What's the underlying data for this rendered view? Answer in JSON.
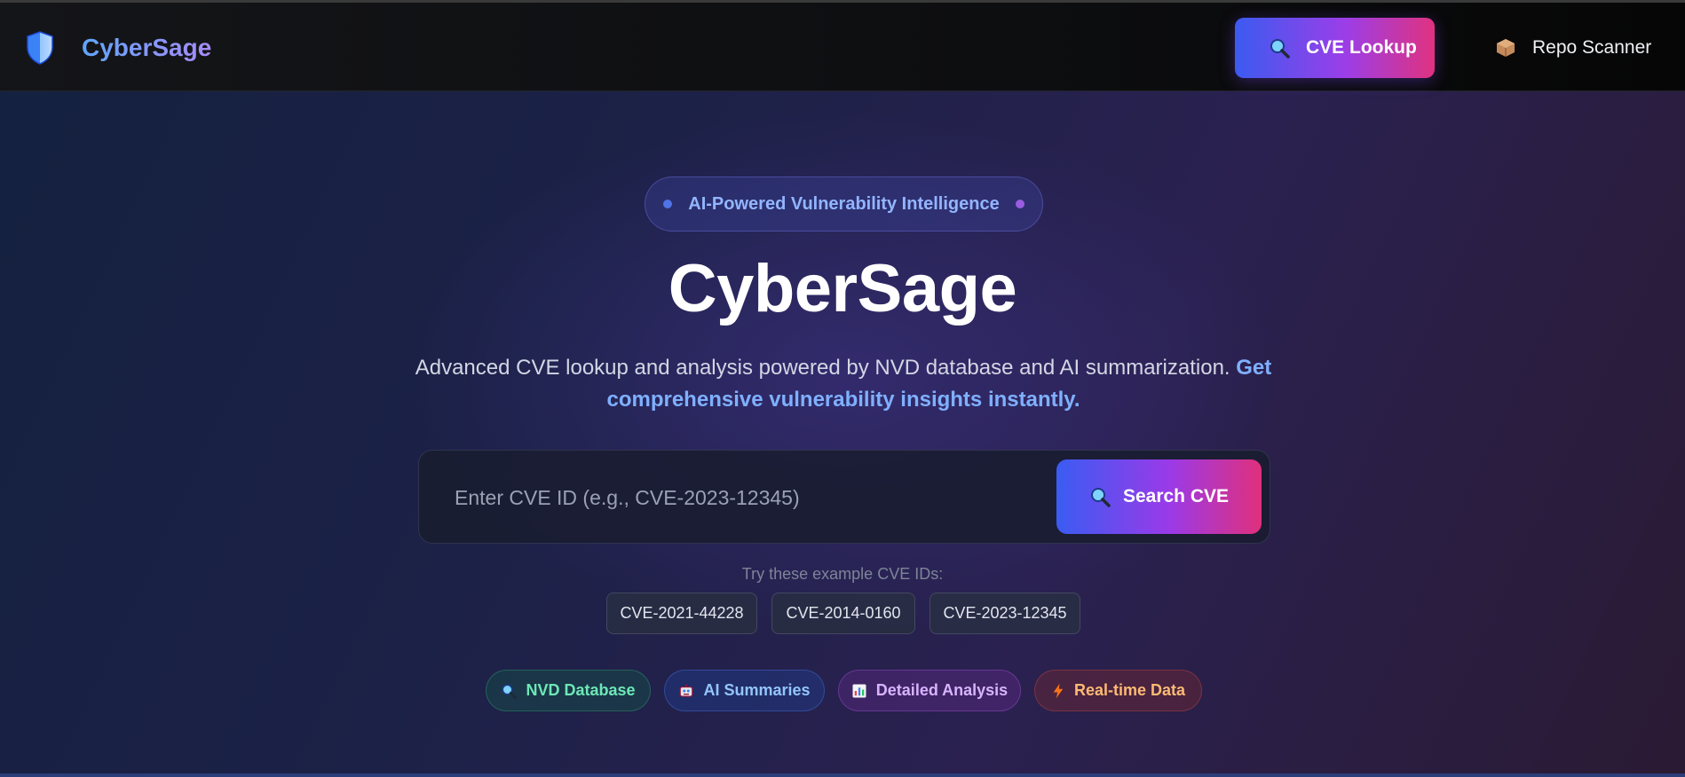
{
  "navbar": {
    "brand_name": "CyberSage",
    "brand_icon": "shield-icon",
    "links": [
      {
        "label": "CVE Lookup",
        "icon": "magnifier-icon",
        "active": true
      },
      {
        "label": "Repo Scanner",
        "icon": "package-icon",
        "active": false
      }
    ]
  },
  "hero": {
    "badge": "AI-Powered Vulnerability Intelligence",
    "title": "CyberSage",
    "subtitle": "Advanced CVE lookup and analysis powered by NVD database and AI summarization.",
    "subtitle_highlight": "Get comprehensive vulnerability insights instantly."
  },
  "search": {
    "placeholder": "Enter CVE ID (e.g., CVE-2023-12345)",
    "value": "",
    "button_label": "Search CVE",
    "button_icon": "magnifier-icon"
  },
  "examples": {
    "label": "Try these example CVE IDs:",
    "items": [
      "CVE-2021-44228",
      "CVE-2014-0160",
      "CVE-2023-12345"
    ]
  },
  "features": [
    {
      "label": "NVD Database",
      "icon": "magnifier-icon",
      "color": "#6ee7b7"
    },
    {
      "label": "AI Summaries",
      "icon": "robot-icon",
      "color": "#93c5fd"
    },
    {
      "label": "Detailed Analysis",
      "icon": "bar-chart-icon",
      "color": "#d8b4fe"
    },
    {
      "label": "Real-time Data",
      "icon": "lightning-icon",
      "color": "#fdba74"
    }
  ],
  "colors": {
    "accent_gradient_start": "#3b5bf0",
    "accent_gradient_mid": "#9b3ee8",
    "accent_gradient_end": "#e0327f",
    "highlight_text": "#7fb0ff"
  }
}
